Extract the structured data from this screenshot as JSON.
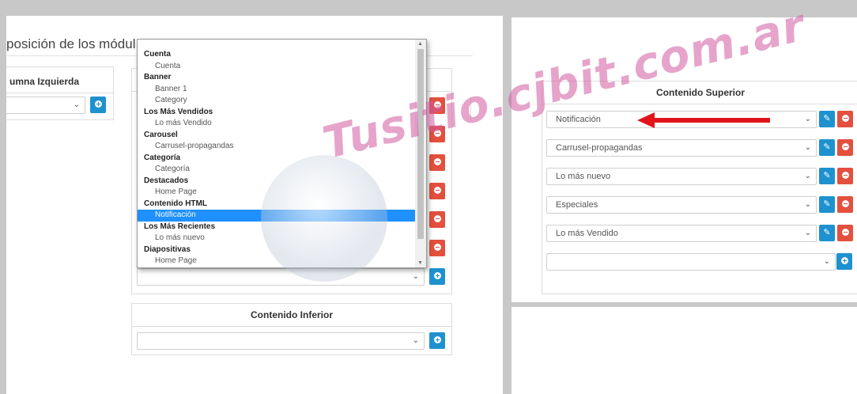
{
  "left": {
    "heading": "posición de los módul",
    "column_left_title": "umna Izquierda",
    "bottom_card_title": "Contenido Inferior"
  },
  "dropdown": {
    "options": [
      {
        "label": "Cuenta",
        "group": true
      },
      {
        "label": "Cuenta",
        "group": false
      },
      {
        "label": "Banner",
        "group": true
      },
      {
        "label": "Banner 1",
        "group": false
      },
      {
        "label": "Category",
        "group": false
      },
      {
        "label": "Los Más Vendidos",
        "group": true
      },
      {
        "label": "Lo más Vendido",
        "group": false
      },
      {
        "label": "Carousel",
        "group": true
      },
      {
        "label": "Carrusel-propagandas",
        "group": false
      },
      {
        "label": "Categoría",
        "group": true
      },
      {
        "label": "Categoría",
        "group": false
      },
      {
        "label": "Destacados",
        "group": true
      },
      {
        "label": "Home Page",
        "group": false
      },
      {
        "label": "Contenido HTML",
        "group": true
      },
      {
        "label": "Notificación",
        "group": false,
        "selected": true
      },
      {
        "label": "Los Más Recientes",
        "group": true
      },
      {
        "label": "Lo más nuevo",
        "group": false
      },
      {
        "label": "Diapositivas",
        "group": true
      },
      {
        "label": "Home Page",
        "group": false
      }
    ]
  },
  "right": {
    "title": "Contenido Superior",
    "rows": [
      {
        "value": "Notificación"
      },
      {
        "value": "Carrusel-propagandas"
      },
      {
        "value": "Lo más nuevo"
      },
      {
        "value": "Especiales"
      },
      {
        "value": "Lo más Vendido"
      },
      {
        "value": ""
      }
    ]
  },
  "watermark": "Tusitio.cjbit.com.ar",
  "colors": {
    "primary": "#1e91cf",
    "danger": "#e3503e",
    "highlight": "#1e90ff",
    "arrow": "#e0151b"
  }
}
